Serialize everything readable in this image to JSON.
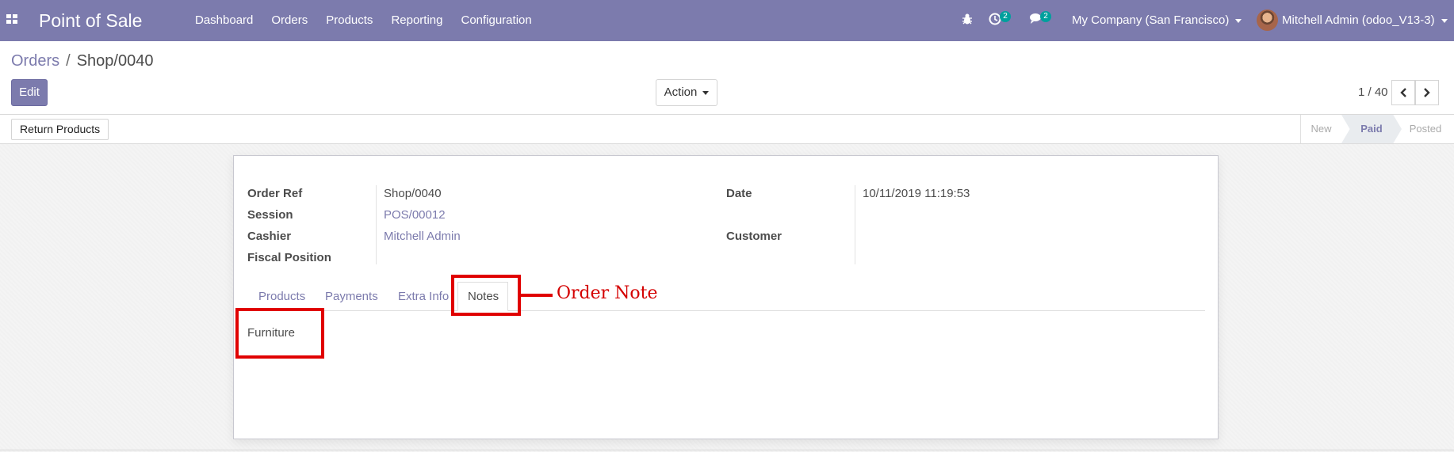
{
  "navbar": {
    "app_title": "Point of Sale",
    "menu": [
      "Dashboard",
      "Orders",
      "Products",
      "Reporting",
      "Configuration"
    ],
    "activity_count": "2",
    "messages_count": "2",
    "company": "My Company (San Francisco)",
    "user": "Mitchell Admin (odoo_V13-3)",
    "color": "#7c7bad"
  },
  "breadcrumb": {
    "parent": "Orders",
    "separator": "/",
    "current": "Shop/0040"
  },
  "controls": {
    "edit_label": "Edit",
    "action_label": "Action",
    "pager": "1 / 40"
  },
  "statusbar": {
    "return_label": "Return Products",
    "stages": [
      "New",
      "Paid",
      "Posted"
    ],
    "active_stage": "Paid"
  },
  "form": {
    "order_ref_label": "Order Ref",
    "order_ref": "Shop/0040",
    "session_label": "Session",
    "session": "POS/00012",
    "cashier_label": "Cashier",
    "cashier": "Mitchell Admin",
    "fiscal_position_label": "Fiscal Position",
    "date_label": "Date",
    "date": "10/11/2019 11:19:53",
    "customer_label": "Customer"
  },
  "tabs": [
    "Products",
    "Payments",
    "Extra Info",
    "Notes"
  ],
  "active_tab": "Notes",
  "notes_content": "Furniture",
  "annotation": {
    "text": "Order Note",
    "color": "#e00000"
  },
  "icons": [
    "apps-icon",
    "bug-icon",
    "activity-clock-icon",
    "messages-icon",
    "chevron-left-icon",
    "chevron-right-icon"
  ]
}
